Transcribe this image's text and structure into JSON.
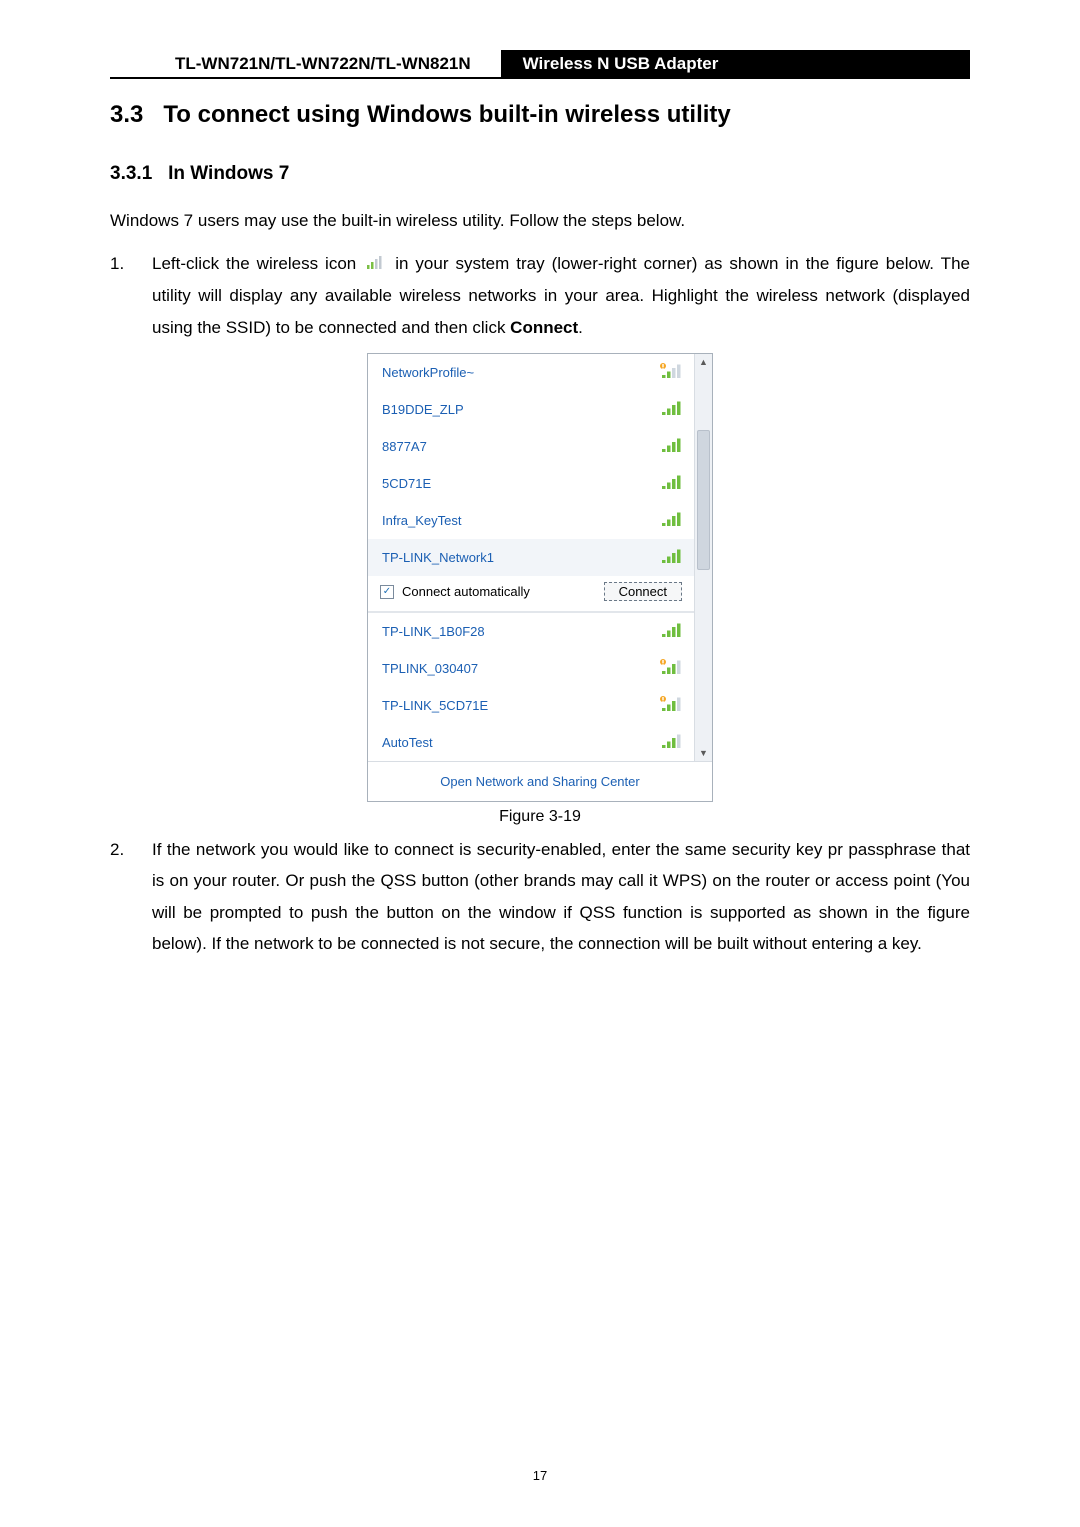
{
  "header": {
    "left": "TL-WN721N/TL-WN722N/TL-WN821N",
    "right": "Wireless N USB Adapter"
  },
  "sec": {
    "num": "3.3",
    "title": "To connect using Windows built-in wireless utility"
  },
  "sub": {
    "num": "3.3.1",
    "title": "In Windows 7"
  },
  "intro": "Windows 7 users may use the built-in wireless utility. Follow the steps below.",
  "step1": {
    "num": "1.",
    "a": "Left-click the wireless icon",
    "b": "in your system tray (lower-right corner) as shown in the figure below. The utility will display any available wireless networks in your area. Highlight the wireless network (displayed using the SSID) to be connected and then click ",
    "c": "Connect",
    "d": "."
  },
  "wifi": {
    "items": [
      {
        "ssid": "NetworkProfile~",
        "signal": "weak-warn"
      },
      {
        "ssid": "B19DDE_ZLP",
        "signal": "strong"
      },
      {
        "ssid": "8877A7",
        "signal": "strong"
      },
      {
        "ssid": "5CD71E",
        "signal": "strong"
      },
      {
        "ssid": "Infra_KeyTest",
        "signal": "strong"
      },
      {
        "ssid": "TP-LINK_Network1",
        "signal": "strong",
        "selected": true
      }
    ],
    "connect_auto": "Connect automatically",
    "connect_btn": "Connect",
    "more": [
      {
        "ssid": "TP-LINK_1B0F28",
        "signal": "strong"
      },
      {
        "ssid": "TPLINK_030407",
        "signal": "med-warn"
      },
      {
        "ssid": "TP-LINK_5CD71E",
        "signal": "med-warn"
      },
      {
        "ssid": "AutoTest",
        "signal": "med"
      }
    ],
    "footer": "Open Network and Sharing Center"
  },
  "fig": "Figure 3-19",
  "step2": {
    "num": "2.",
    "text": "If the network you would like to connect is security-enabled, enter the same security key pr passphrase that is on your router. Or push the QSS button (other brands may call it WPS) on the router or access point (You will be prompted to push the button on the window if QSS function is supported as shown in the figure below). If the network to be connected is not secure, the connection will be built without entering a key."
  },
  "page_number": "17"
}
